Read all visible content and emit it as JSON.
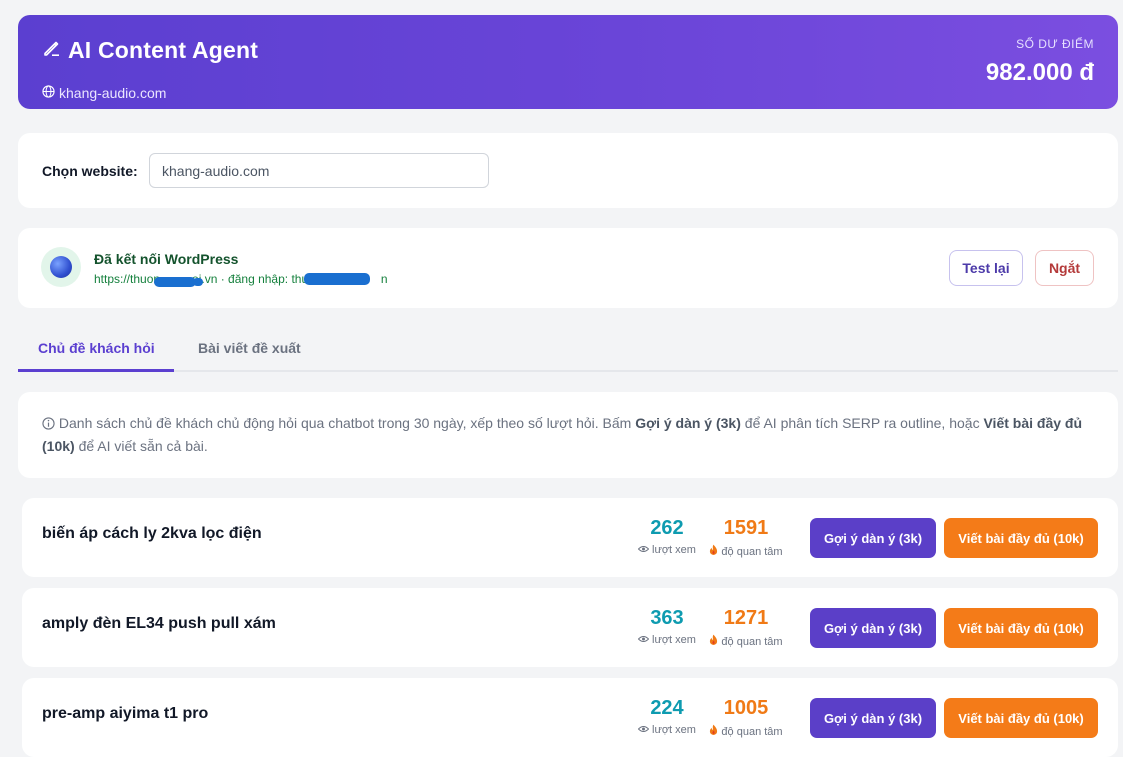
{
  "header": {
    "title": "AI Content Agent",
    "site": "khang-audio.com",
    "balance_label": "SỐ DƯ ĐIỂM",
    "balance_value": "982.000 đ",
    "icons": [
      "pencil-icon",
      "globe-icon"
    ]
  },
  "site_select": {
    "label": "Chọn website:",
    "value": "khang-audio.com"
  },
  "wordpress": {
    "title": "Đã kết nối WordPress",
    "subtitle_prefix": "https://thuon",
    "subtitle_mid": "oi.vn · đăng nhập: thuo",
    "subtitle_suffix": "n",
    "test_button": "Test lại",
    "disconnect_button": "Ngắt"
  },
  "tabs": [
    {
      "label": "Chủ đề khách hỏi",
      "active": true
    },
    {
      "label": "Bài viết đề xuất",
      "active": false
    }
  ],
  "info": {
    "text_1": "Danh sách chủ đề khách chủ động hỏi qua chatbot trong 30 ngày, xếp theo số lượt hỏi. Bấm ",
    "bold_1": "Gợi ý dàn ý (3k)",
    "text_2": " để AI phân tích SERP ra outline, hoặc ",
    "bold_2": "Viết bài đầy đủ (10k)",
    "text_3": " để AI viết sẵn cả bài."
  },
  "row_labels": {
    "views_caption": "lượt xem",
    "interest_caption": "độ quan tâm",
    "outline_button": "Gợi ý dàn ý (3k)",
    "full_button": "Viết bài đầy đủ (10k)"
  },
  "topics": [
    {
      "title": "biến áp cách ly 2kva lọc điện",
      "views": "262",
      "interest": "1591"
    },
    {
      "title": "amply đèn EL34 push pull xám",
      "views": "363",
      "interest": "1271"
    },
    {
      "title": "pre-amp aiyima t1 pro",
      "views": "224",
      "interest": "1005"
    }
  ],
  "colors": {
    "brand": "#5b3fd0",
    "views": "#0e9bb0",
    "interest": "#f07a16",
    "full_button": "#f47b18",
    "connected_green": "#15803d"
  }
}
